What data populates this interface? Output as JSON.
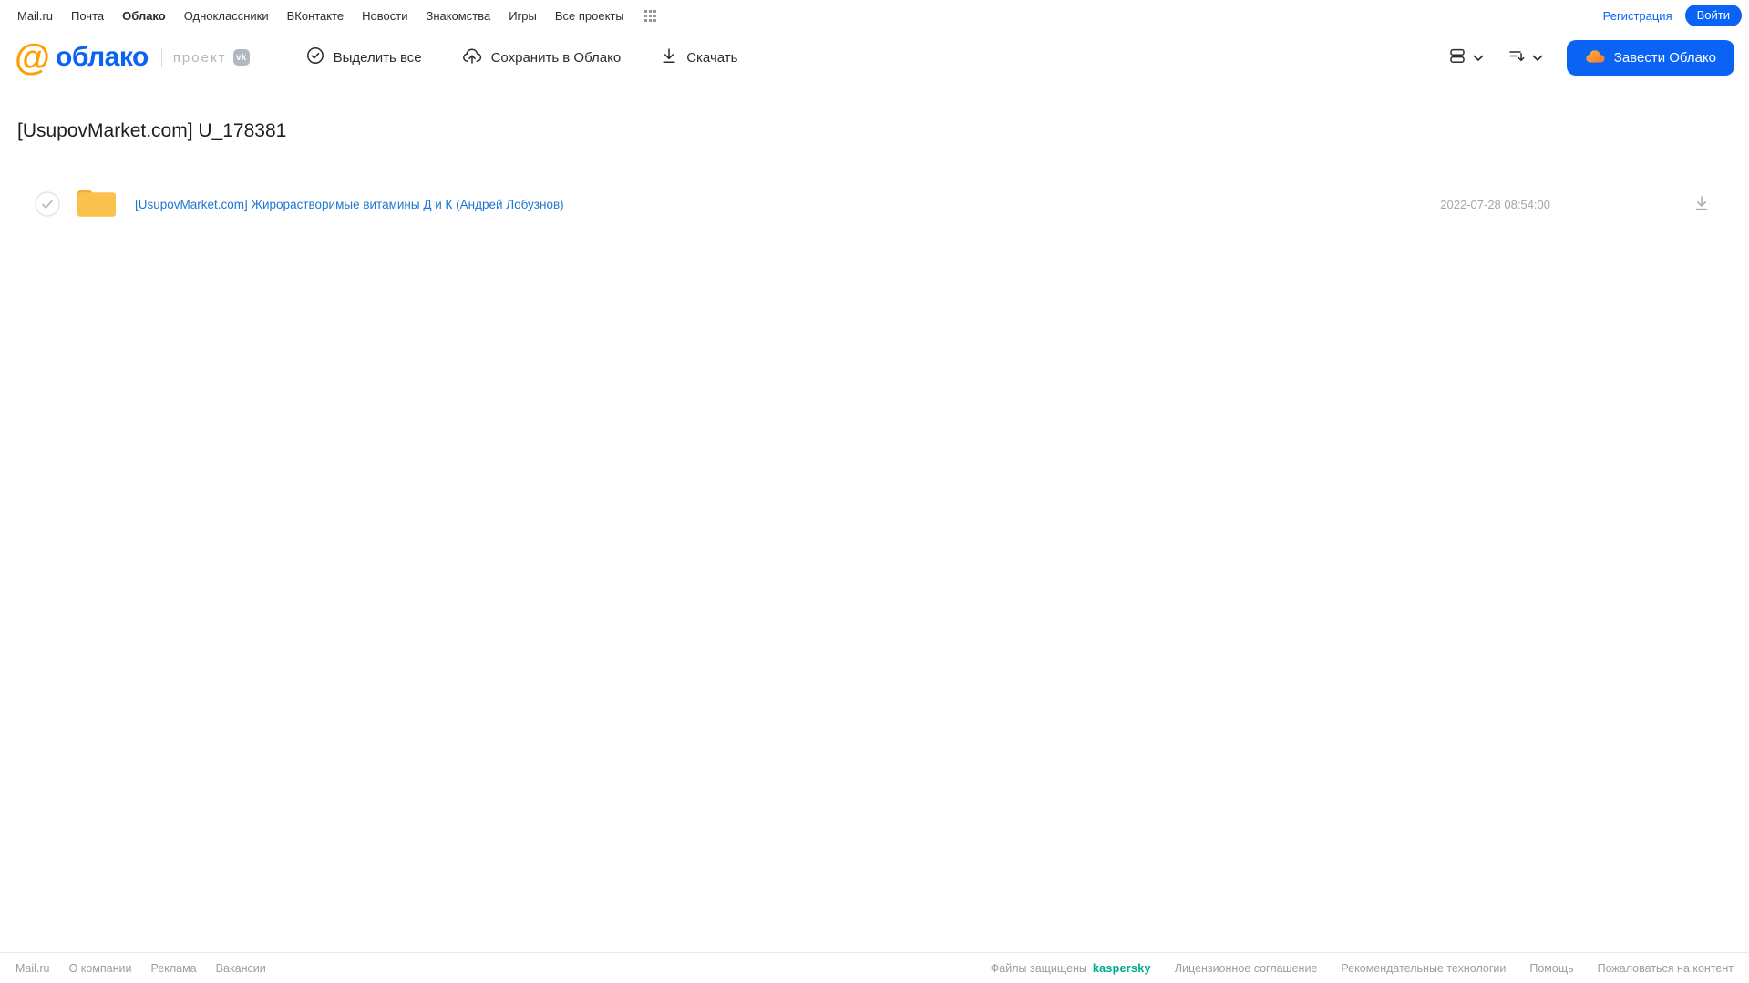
{
  "colors": {
    "accent_blue": "#0b63f6",
    "logo_orange": "#ff9e00",
    "folder_yellow": "#fbc14d",
    "kaspersky_green": "#00a88e",
    "link_blue": "#2176d2"
  },
  "topnav": {
    "items": [
      "Mail.ru",
      "Почта",
      "Облако",
      "Одноклассники",
      "ВКонтакте",
      "Новости",
      "Знакомства",
      "Игры",
      "Все проекты"
    ],
    "active_item": "Облако",
    "registration_label": "Регистрация",
    "login_label": "Войти"
  },
  "header": {
    "logo_at": "@",
    "logo_text": "облако",
    "project_label": "проект",
    "vk_badge": "vk",
    "toolbar": {
      "select_all_label": "Выделить все",
      "save_to_cloud_label": "Сохранить в Облако",
      "download_label": "Скачать"
    },
    "get_cloud_label": "Завести Облако"
  },
  "main": {
    "title": "[UsupovMarket.com] U_178381",
    "files": [
      {
        "name": "[UsupovMarket.com] Жирорастворимые витамины Д и К (Андрей Лобузнов)",
        "date": "2022-07-28 08:54:00",
        "type": "folder"
      }
    ]
  },
  "footer": {
    "left_links": [
      "Mail.ru",
      "О компании",
      "Реклама",
      "Вакансии"
    ],
    "protected_text": "Файлы защищены",
    "kaspersky_label": "kaspersky",
    "right_links": [
      "Лицензионное соглашение",
      "Рекомендательные технологии",
      "Помощь",
      "Пожаловаться на контент"
    ]
  }
}
